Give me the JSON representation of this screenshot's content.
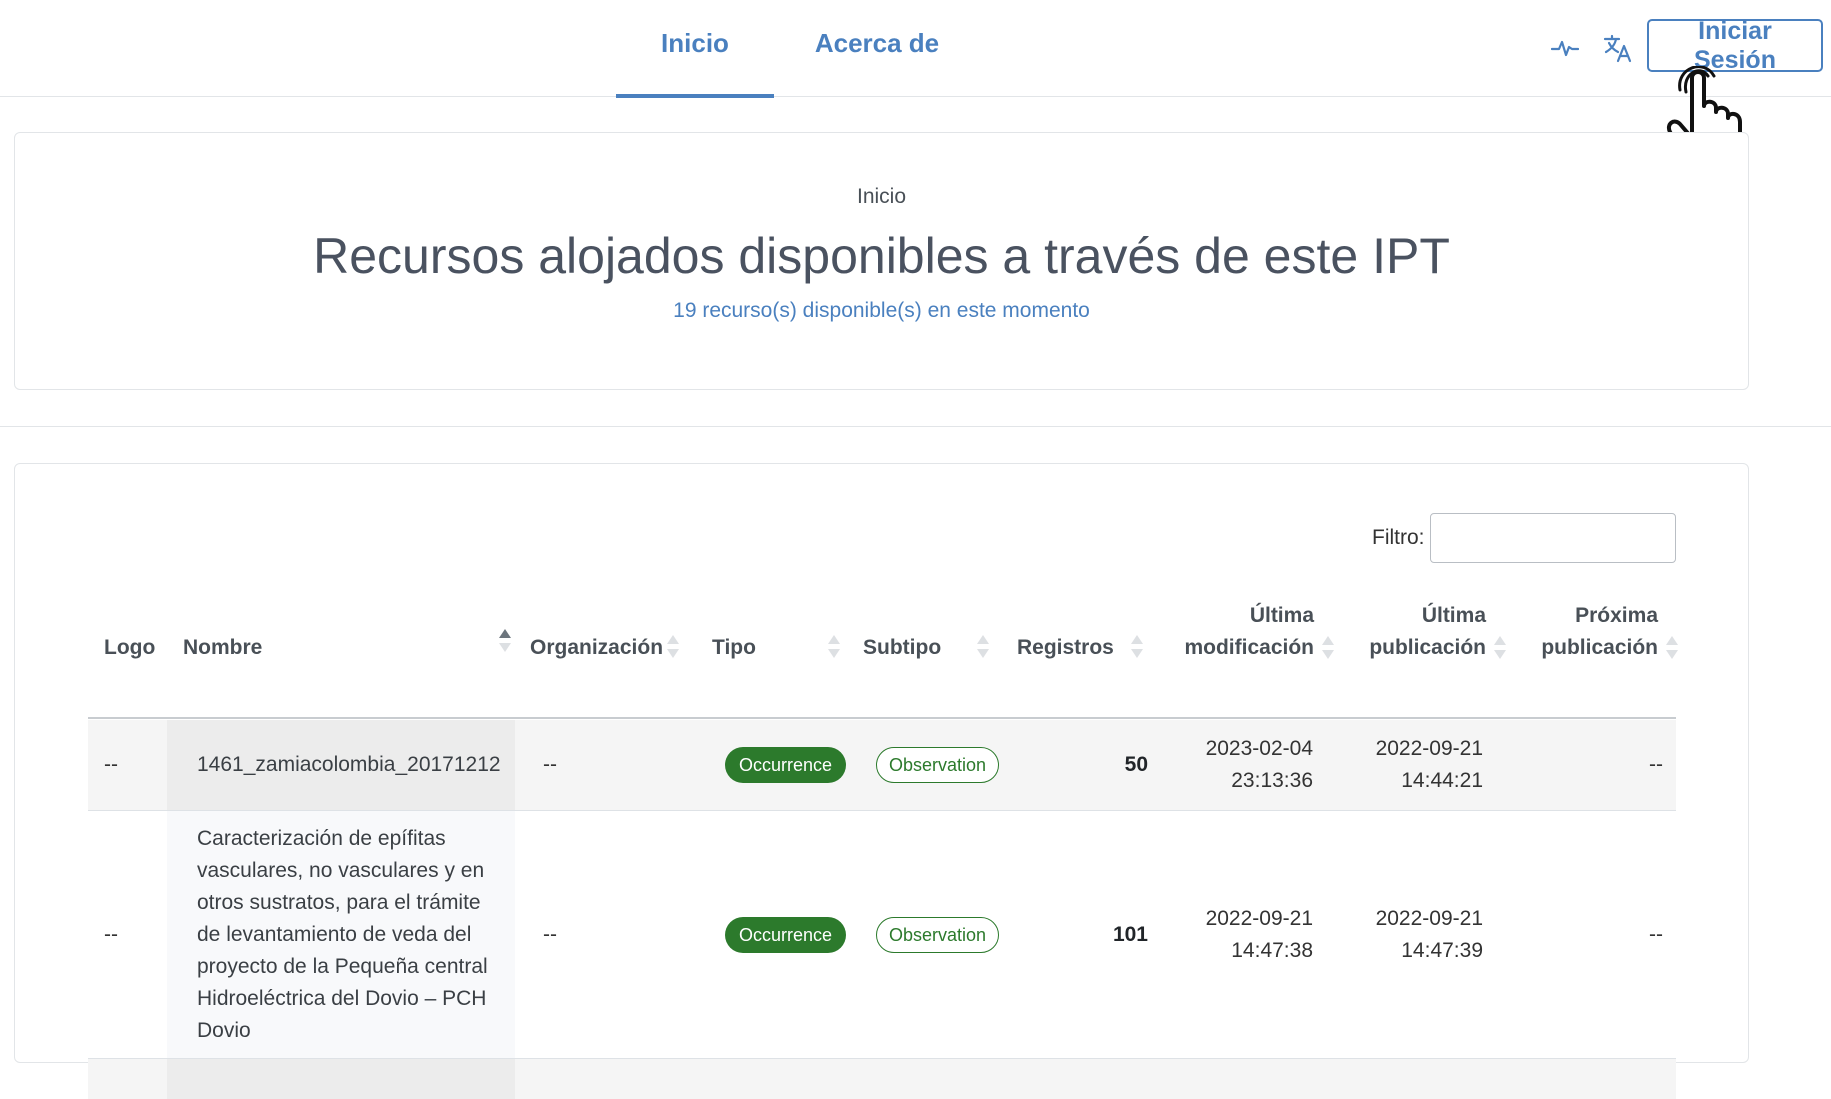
{
  "nav": {
    "home_label": "Inicio",
    "about_label": "Acerca de",
    "health_icon": "activity-icon",
    "language_icon": "translate-icon",
    "login_label": "Iniciar Sesión",
    "accent_color": "#4a80bf"
  },
  "header": {
    "breadcrumb": "Inicio",
    "title": "Recursos alojados disponibles a través de este IPT",
    "resource_count": "19 recurso(s) disponible(s) en este momento"
  },
  "table": {
    "filter_label": "Filtro:",
    "filter_value": "",
    "columns": {
      "logo": "Logo",
      "name": "Nombre",
      "organization": "Organización",
      "type": "Tipo",
      "subtype": "Subtipo",
      "records": "Registros",
      "last_modified_1": "Última",
      "last_modified_2": "modificación",
      "last_published_1": "Última",
      "last_published_2": "publicación",
      "next_published_1": "Próxima",
      "next_published_2": "publicación"
    },
    "rows": [
      {
        "logo": "--",
        "name_lines": [
          "1461_zamiacolombia_20171212"
        ],
        "organization": "--",
        "type": "Occurrence",
        "subtype": "Observation",
        "records": "50",
        "last_modified_date": "2023-02-04",
        "last_modified_time": "23:13:36",
        "last_published_date": "2022-09-21",
        "last_published_time": "14:44:21",
        "next_published": "--"
      },
      {
        "logo": "--",
        "name_lines": [
          "Caracterización de epífitas",
          "vasculares, no vasculares y en",
          "otros sustratos, para el trámite",
          "de levantamiento de veda del",
          "proyecto de la Pequeña central",
          "Hidroeléctrica del Dovio – PCH",
          "Dovio"
        ],
        "organization": "--",
        "type": "Occurrence",
        "subtype": "Observation",
        "records": "101",
        "last_modified_date": "2022-09-21",
        "last_modified_time": "14:47:38",
        "last_published_date": "2022-09-21",
        "last_published_time": "14:47:39",
        "next_published": "--"
      }
    ],
    "badge_color": "#2c7a2c"
  }
}
